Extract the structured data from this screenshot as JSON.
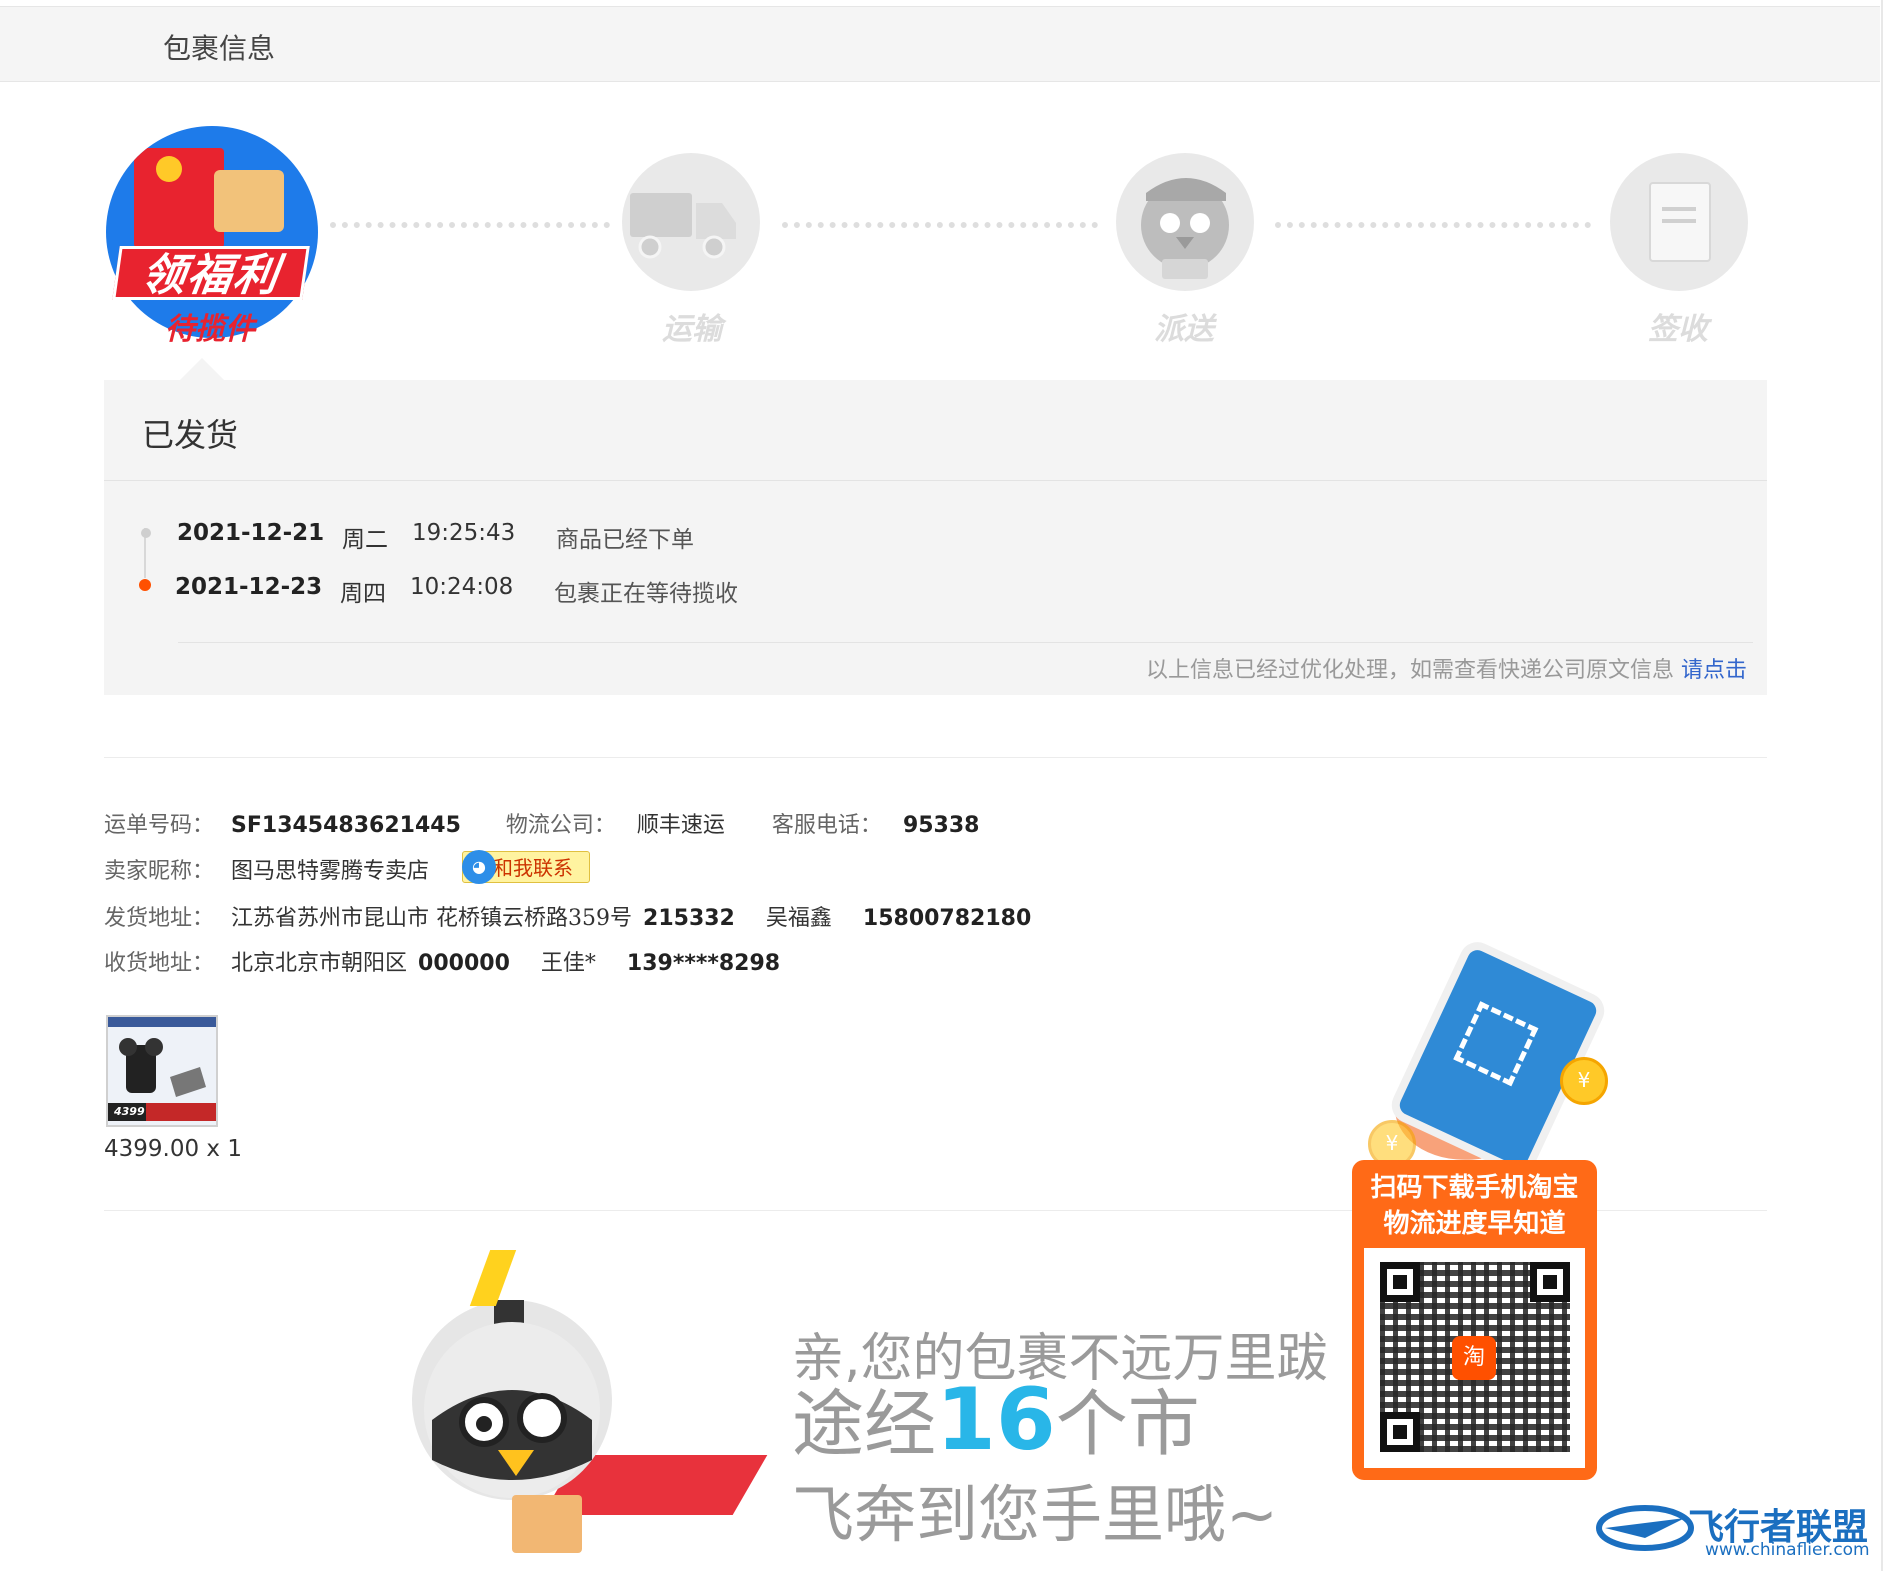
{
  "header": {
    "title": "包裹信息"
  },
  "steps": {
    "promo_banner": "领福利",
    "promo_label": "待揽件",
    "labels": [
      "运输",
      "派送",
      "签收"
    ]
  },
  "status": {
    "title": "已发货",
    "events": [
      {
        "date": "2021-12-21",
        "weekday": "周二",
        "time": "19:25:43",
        "desc": "商品已经下单"
      },
      {
        "date": "2021-12-23",
        "weekday": "周四",
        "time": "10:24:08",
        "desc": "包裹正在等待揽收"
      }
    ],
    "note": "以上信息已经过优化处理，如需查看快递公司原文信息",
    "note_link": "请点击"
  },
  "shipment": {
    "waybill_label": "运单号码：",
    "waybill": "SF1345483621445",
    "company_label": "物流公司：",
    "company": "顺丰速运",
    "phone_label": "客服电话：",
    "phone": "95338",
    "seller_label": "卖家昵称：",
    "seller": "图马思特雾腾专卖店",
    "contact_button": "和我联系",
    "from_label": "发货地址：",
    "from_address": "江苏省苏州市昆山市 花桥镇云桥路359号",
    "from_zip": "215332",
    "from_name": "吴福鑫",
    "from_phone": "15800782180",
    "to_label": "收货地址：",
    "to_address": "北京北京市朝阳区",
    "to_zip": "000000",
    "to_name": "王佳*",
    "to_phone": "139****8298"
  },
  "product": {
    "price_qty": "4399.00 x 1",
    "thumb_badge": "4399"
  },
  "promo": {
    "line1": "亲,您的包裹不远万里跋",
    "line2_prefix": "途经",
    "line2_num": "16",
    "line2_suffix": "个市",
    "line3": "飞奔到您手里哦~"
  },
  "qr": {
    "line1": "扫码下载手机淘宝",
    "line2": "物流进度早知道",
    "center": "淘"
  },
  "watermark": {
    "name": "飞行者联盟",
    "url": "www.chinaflier.com"
  },
  "colors": {
    "accent": "#ff5000",
    "link": "#3366cc",
    "qr_bg": "#ff6a17",
    "promo_num": "#29b6e8"
  }
}
